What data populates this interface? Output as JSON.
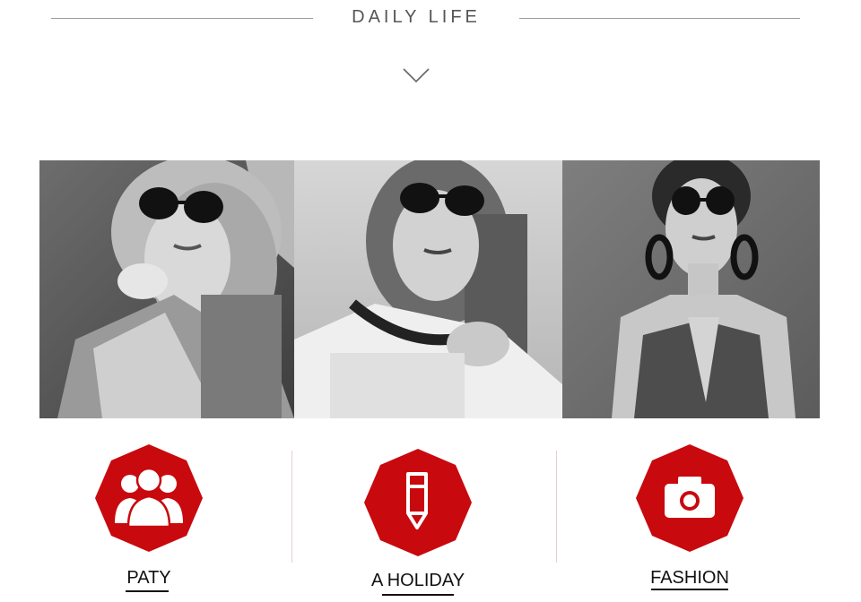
{
  "header": {
    "title": "DAILY LIFE"
  },
  "photos": [
    {
      "icon": "woman-sunglasses-photo"
    },
    {
      "icon": "woman-sunglasses-photo"
    },
    {
      "icon": "woman-sunglasses-photo"
    }
  ],
  "features": [
    {
      "label": "PATY",
      "icon": "group-people-icon"
    },
    {
      "label": "A HOLIDAY",
      "icon": "pencil-icon"
    },
    {
      "label": "FASHION",
      "icon": "camera-icon"
    }
  ],
  "colors": {
    "accent": "#c8090e",
    "text": "#111111",
    "header_text": "#555555",
    "rule": "#9a9a9a"
  }
}
